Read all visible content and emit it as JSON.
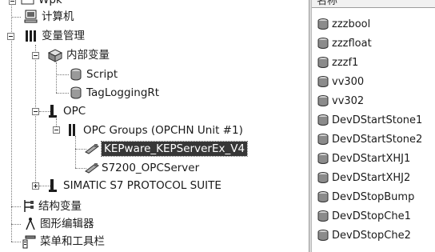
{
  "tree": {
    "root_label": "Wpk",
    "computer": "计算机",
    "var_mgmt": "变量管理",
    "internal_vars": "内部变量",
    "script": "Script",
    "tag_logging": "TagLoggingRt",
    "opc": "OPC",
    "opc_groups": "OPC Groups (OPCHN Unit #1)",
    "kepware": "KEPware_KEPServerEx_V4",
    "s7200": "S7200_OPCServer",
    "simatic": "SIMATIC S7 PROTOCOL SUITE",
    "struct_vars": "结构变量",
    "graphics_editor": "图形编辑器",
    "menu_toolbar": "菜单和工具栏"
  },
  "list": {
    "header": "名称",
    "items": [
      "zzzbool",
      "zzzfloat",
      "zzzf1",
      "vv300",
      "vv302",
      "DevDStartStone1",
      "DevDStartStone2",
      "DevDStartXHJ1",
      "DevDStartXHJ2",
      "DevDStopBump",
      "DevDStopChe1",
      "DevDStopChe2"
    ]
  }
}
